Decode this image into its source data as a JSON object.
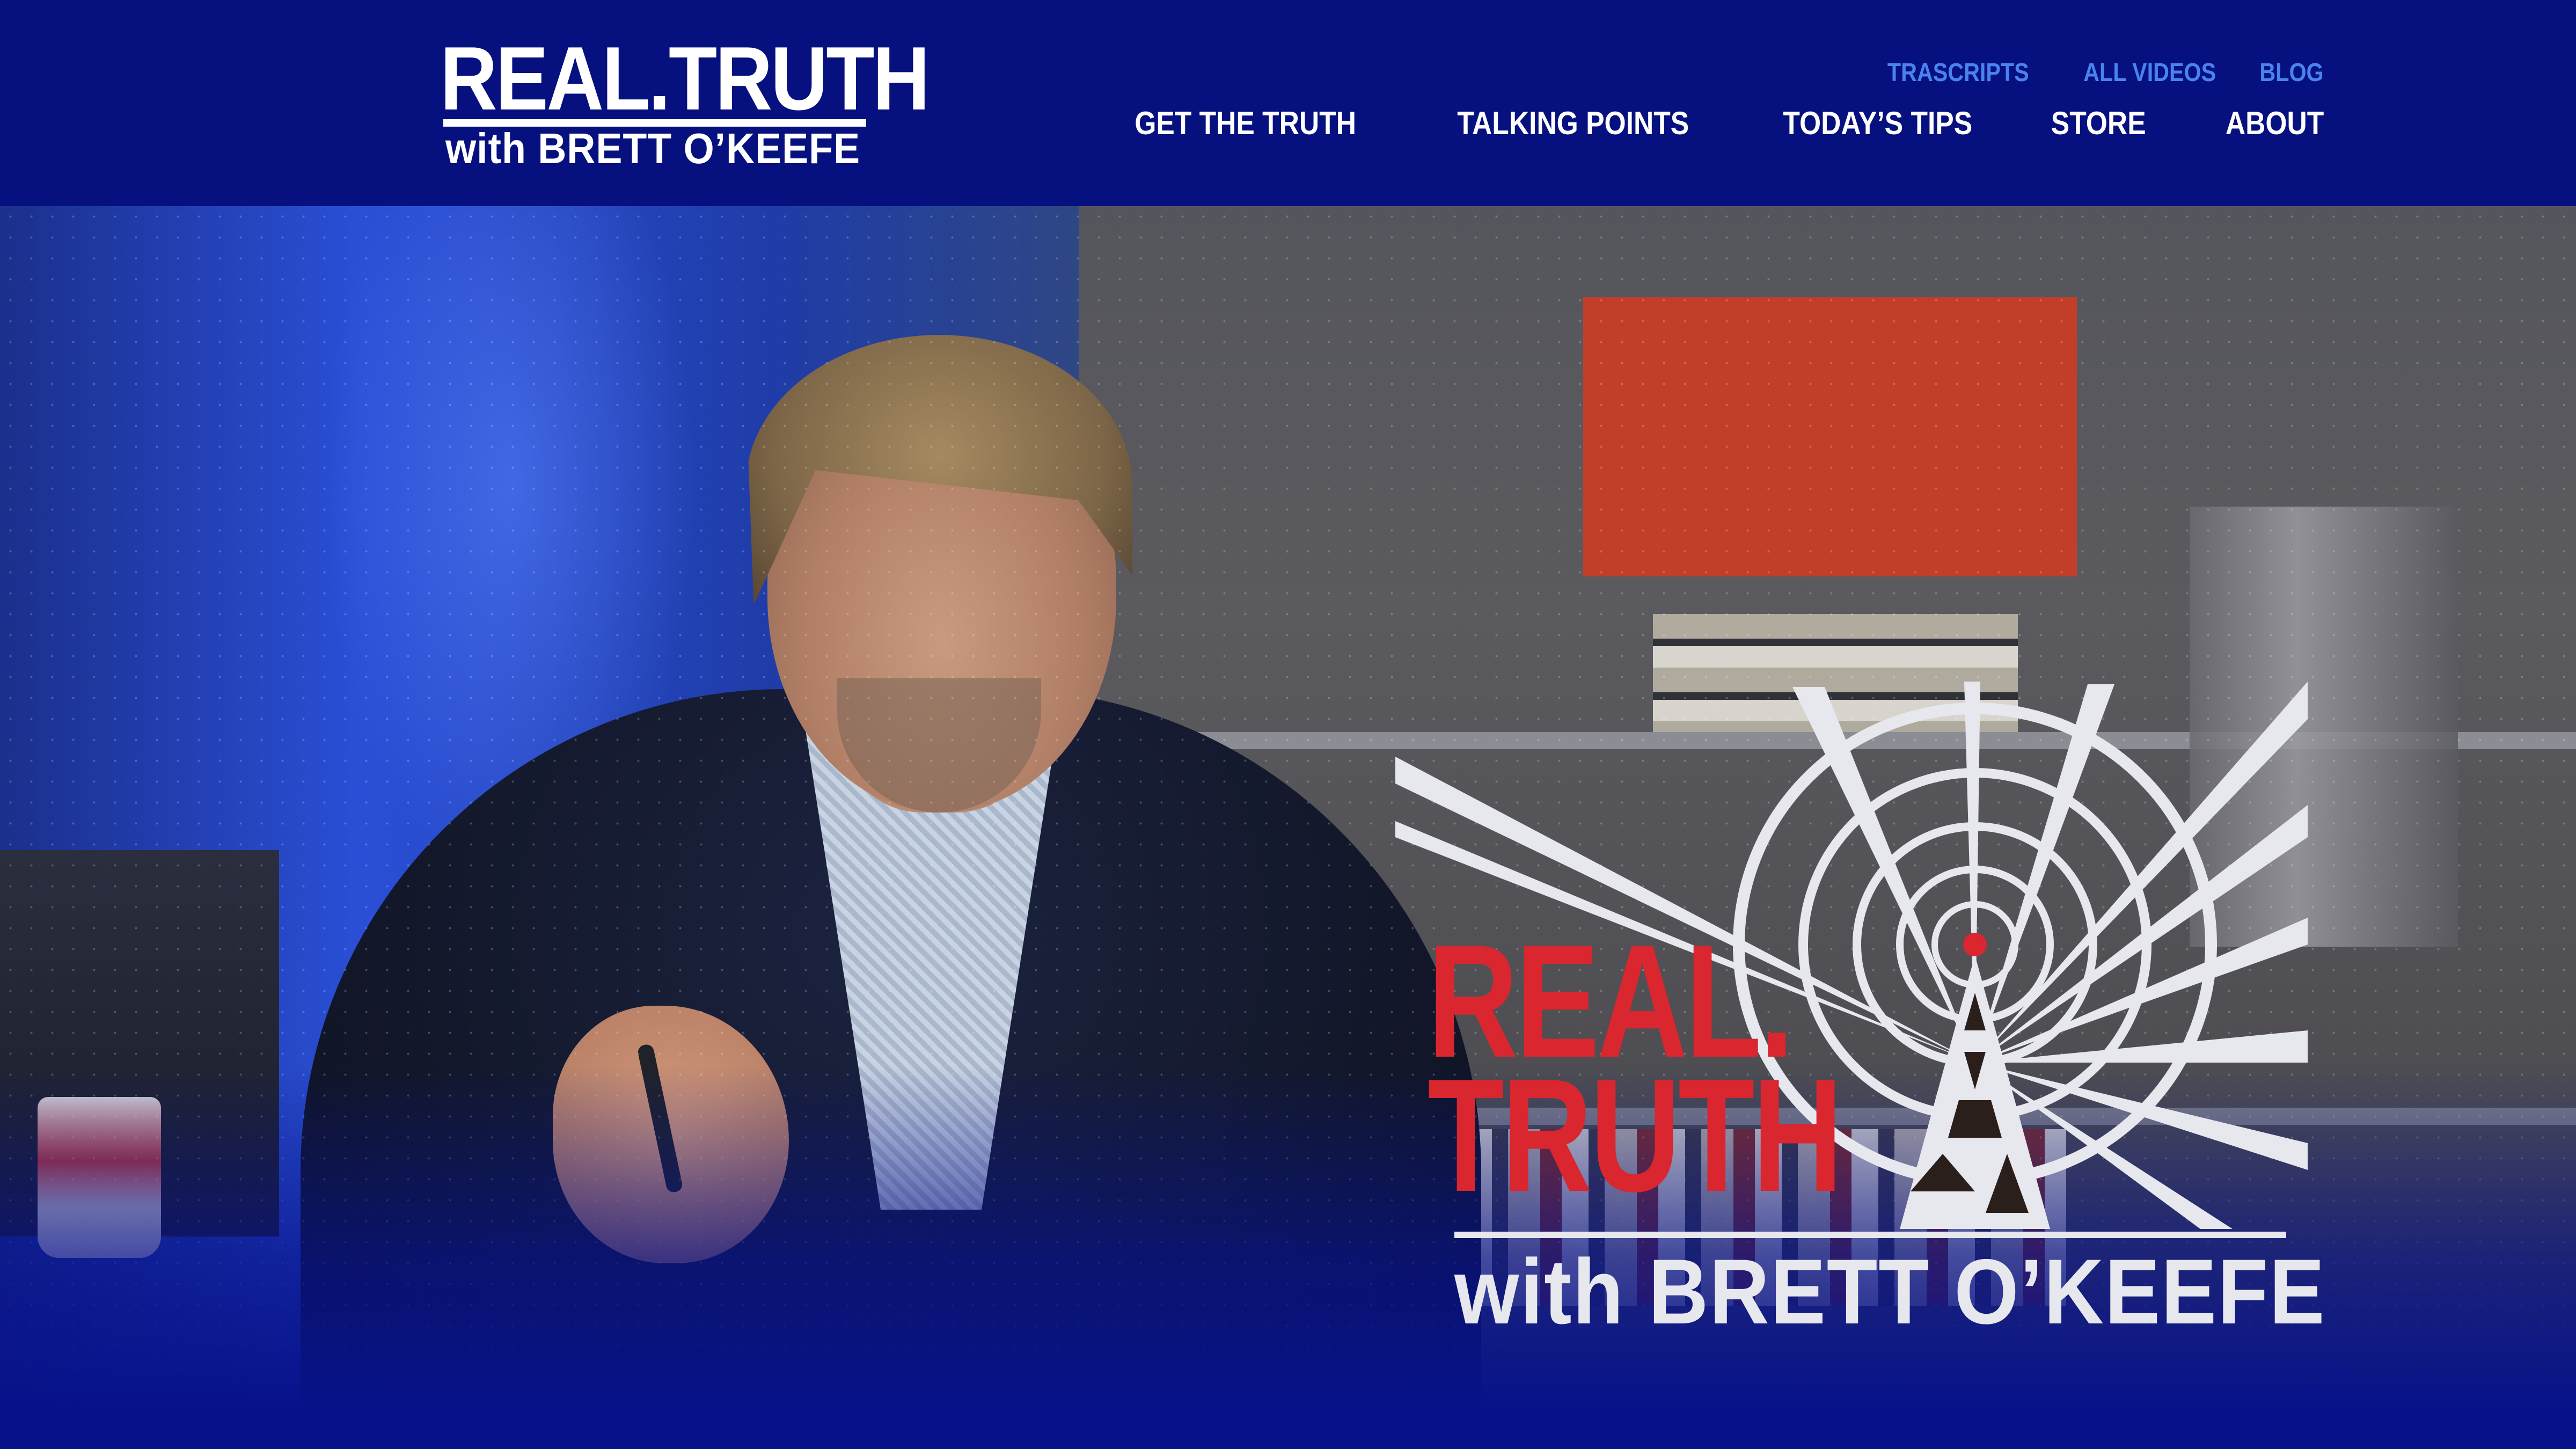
{
  "header": {
    "logo": {
      "line1": "REAL.TRUTH",
      "line2": "with BRETT O’KEEFE"
    },
    "secondary_nav": [
      {
        "label": "TRASCRIPTS"
      },
      {
        "label": "ALL VIDEOS"
      },
      {
        "label": "BLOG"
      }
    ],
    "main_nav": [
      {
        "label": "GET THE TRUTH"
      },
      {
        "label": "TALKING POINTS"
      },
      {
        "label": "TODAY’S TIPS"
      },
      {
        "label": "STORE"
      },
      {
        "label": "ABOUT"
      }
    ]
  },
  "hero": {
    "image": "host-at-desk-photo",
    "show_logo": {
      "line1": "REAL.",
      "line2": "TRUTH",
      "line3": "with BRETT O’KEEFE",
      "icon": "radio-tower-broadcast-icon"
    }
  },
  "colors": {
    "header_bg": "#06117f",
    "secondary_nav": "#4a82ee",
    "main_nav": "#ffffff",
    "logo_red": "#d9262f",
    "logo_white": "#e7e7ee"
  }
}
